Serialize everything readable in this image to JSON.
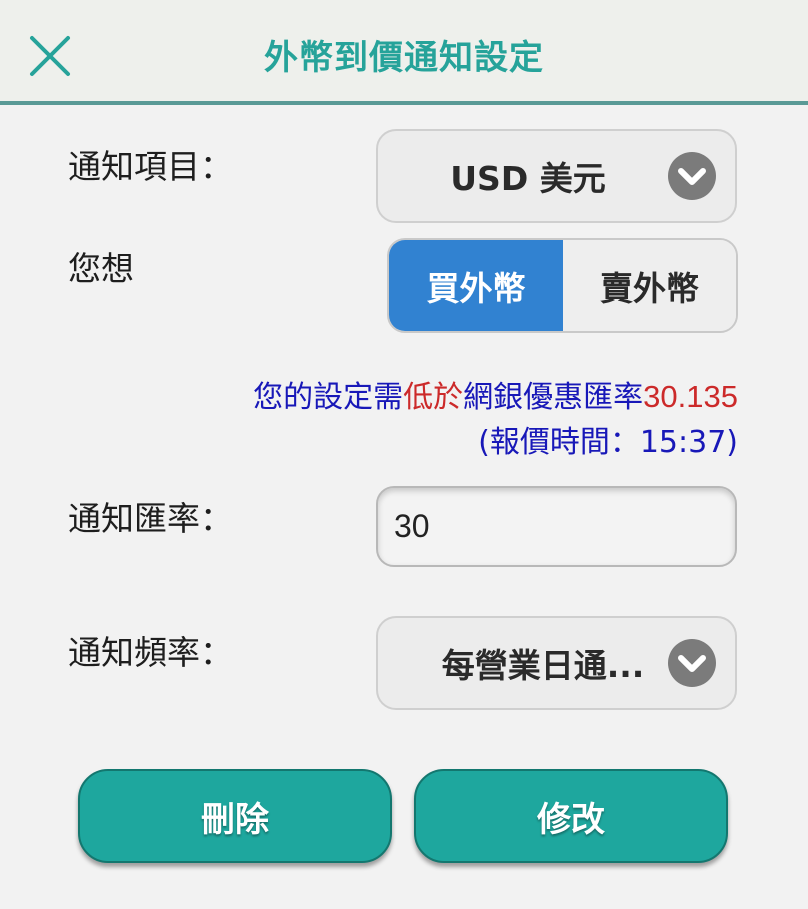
{
  "header": {
    "title": "外幣到價通知設定",
    "close_icon": "close-icon"
  },
  "notify_item": {
    "label": "通知項目：",
    "value": "USD 美元",
    "dropdown_icon": "chevron-down-icon"
  },
  "direction": {
    "label": "您想",
    "options": [
      "買外幣",
      "賣外幣"
    ],
    "selected": "買外幣"
  },
  "hint": {
    "prefix": "您的設定需",
    "condition": "低於",
    "middle": "網銀優惠匯率",
    "rate": "30.135",
    "quote_time": "(報價時間：15:37)"
  },
  "notify_rate": {
    "label": "通知匯率：",
    "value": "30",
    "placeholder": ""
  },
  "notify_frequency": {
    "label": "通知頻率：",
    "value": "每營業日通...",
    "dropdown_icon": "chevron-down-icon"
  },
  "actions": {
    "delete_label": "刪除",
    "edit_label": "修改"
  },
  "colors": {
    "accent": "#1ea79e",
    "header_title": "#26a39a",
    "selected_segment": "#3182d1",
    "hint_blue": "#1818b8",
    "hint_red": "#cc2a2a"
  }
}
